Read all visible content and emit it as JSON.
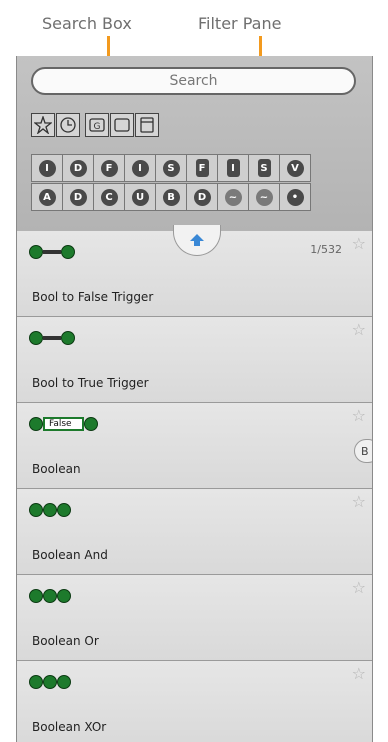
{
  "annotations": {
    "search_box": "Search Box",
    "filter_pane": "Filter Pane"
  },
  "search": {
    "placeholder": "Search"
  },
  "tools": [
    {
      "name": "star-icon"
    },
    {
      "name": "clock-icon"
    },
    {
      "name": "g-icon"
    },
    {
      "name": "square-icon"
    },
    {
      "name": "window-icon"
    }
  ],
  "filters_row1": [
    "I",
    "D",
    "F",
    "I",
    "S",
    "F",
    "I",
    "S",
    "V"
  ],
  "filters_row2": [
    "A",
    "D",
    "C",
    "U",
    "B",
    "D",
    "~",
    "~",
    "•"
  ],
  "list": {
    "count": "1/532",
    "b_button": "B",
    "false_label": "False",
    "items": [
      {
        "name": "Bool to False Trigger"
      },
      {
        "name": "Bool to True Trigger"
      },
      {
        "name": "Boolean"
      },
      {
        "name": "Boolean And"
      },
      {
        "name": "Boolean Or"
      },
      {
        "name": "Boolean XOr"
      }
    ]
  }
}
